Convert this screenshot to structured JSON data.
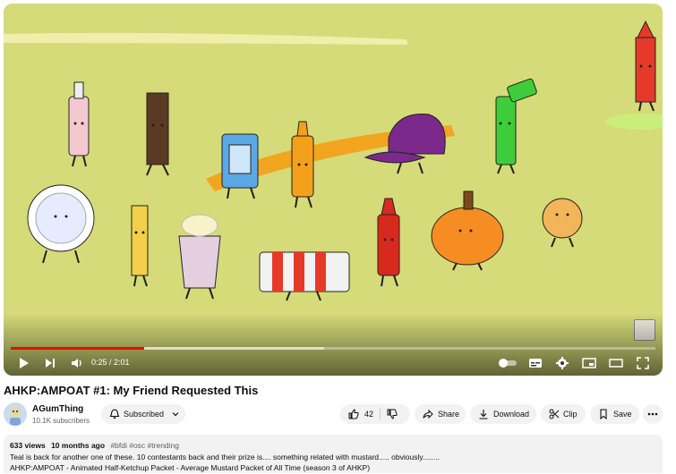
{
  "player": {
    "time_current": "0:25",
    "time_total": "2:01",
    "timecode": "0:25 / 2:01",
    "progress_fraction": 0.207,
    "buffered_fraction": 0.486,
    "scene_bg": "#d6db79",
    "accent": "#ff0000",
    "controls": [
      "play-icon",
      "next-icon",
      "volume-icon",
      "autoplay-toggle",
      "subtitles-icon",
      "settings-icon",
      "miniplayer-icon",
      "theater-icon",
      "fullscreen-icon"
    ]
  },
  "video": {
    "title": "AHKP:AMPOAT #1: My Friend Requested This"
  },
  "channel": {
    "name": "AGumThing",
    "subscribers": "10.1K subscribers"
  },
  "actions": {
    "subscribed_label": "Subscribed",
    "like_count": "42",
    "share_label": "Share",
    "download_label": "Download",
    "clip_label": "Clip",
    "save_label": "Save"
  },
  "description": {
    "views": "633 views",
    "age": "10 months ago",
    "tags": "#bfdi #osc #trending",
    "line1": "Teal is back for another one of these. 10 contestants back and their prize is.... something related with mustard..... obviously........",
    "line2": "AHKP:AMPOAT - Animated Half-Ketchup Packet - Average Mustard Packet of All Time (season 3 of AHKP)"
  }
}
